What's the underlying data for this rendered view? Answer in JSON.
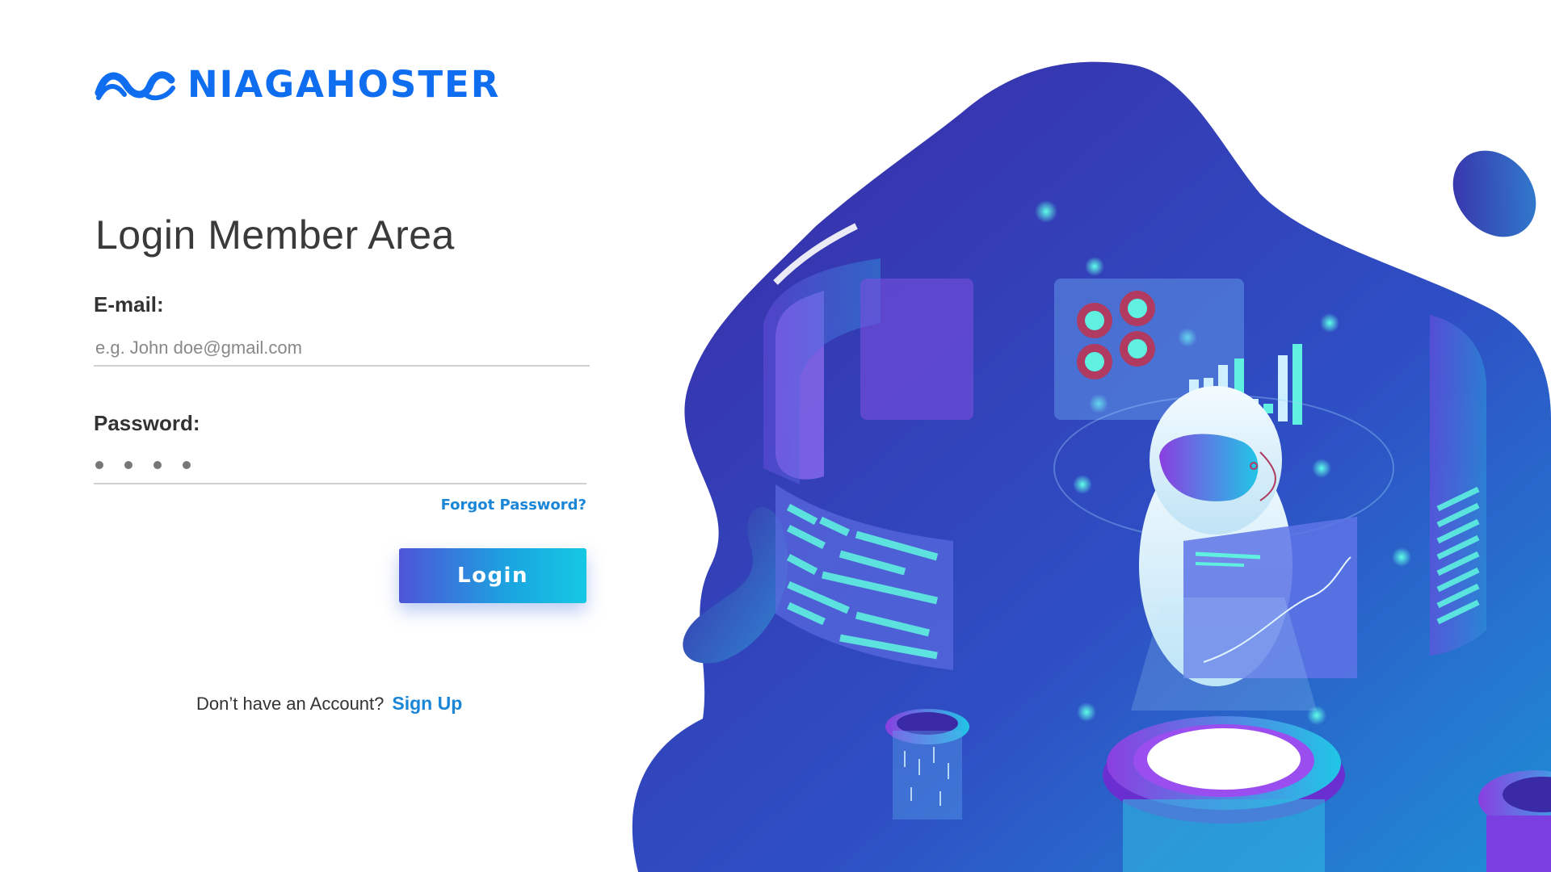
{
  "brand": {
    "name": "NIAGAHOSTER",
    "color": "#0f6df0",
    "logo_icon": "wave-logo-icon"
  },
  "login": {
    "title": "Login Member Area",
    "email_label": "E-mail:",
    "email_placeholder": "e.g. John doe@gmail.com",
    "password_label": "Password:",
    "password_mask_dots": 4,
    "forgot_link": "Forgot Password?",
    "submit_label": "Login",
    "signup_prompt": "Don’t have an Account?",
    "signup_link": "Sign Up"
  },
  "colors": {
    "accent": "#1a86d8",
    "button_gradient_start": "#4e55d8",
    "button_gradient_end": "#16c8e4",
    "illustration_primary": "#3f2aa8",
    "illustration_secondary": "#1f8fd6"
  },
  "illustration": {
    "subject": "robot-astronaut-with-holographic-dashboard"
  }
}
